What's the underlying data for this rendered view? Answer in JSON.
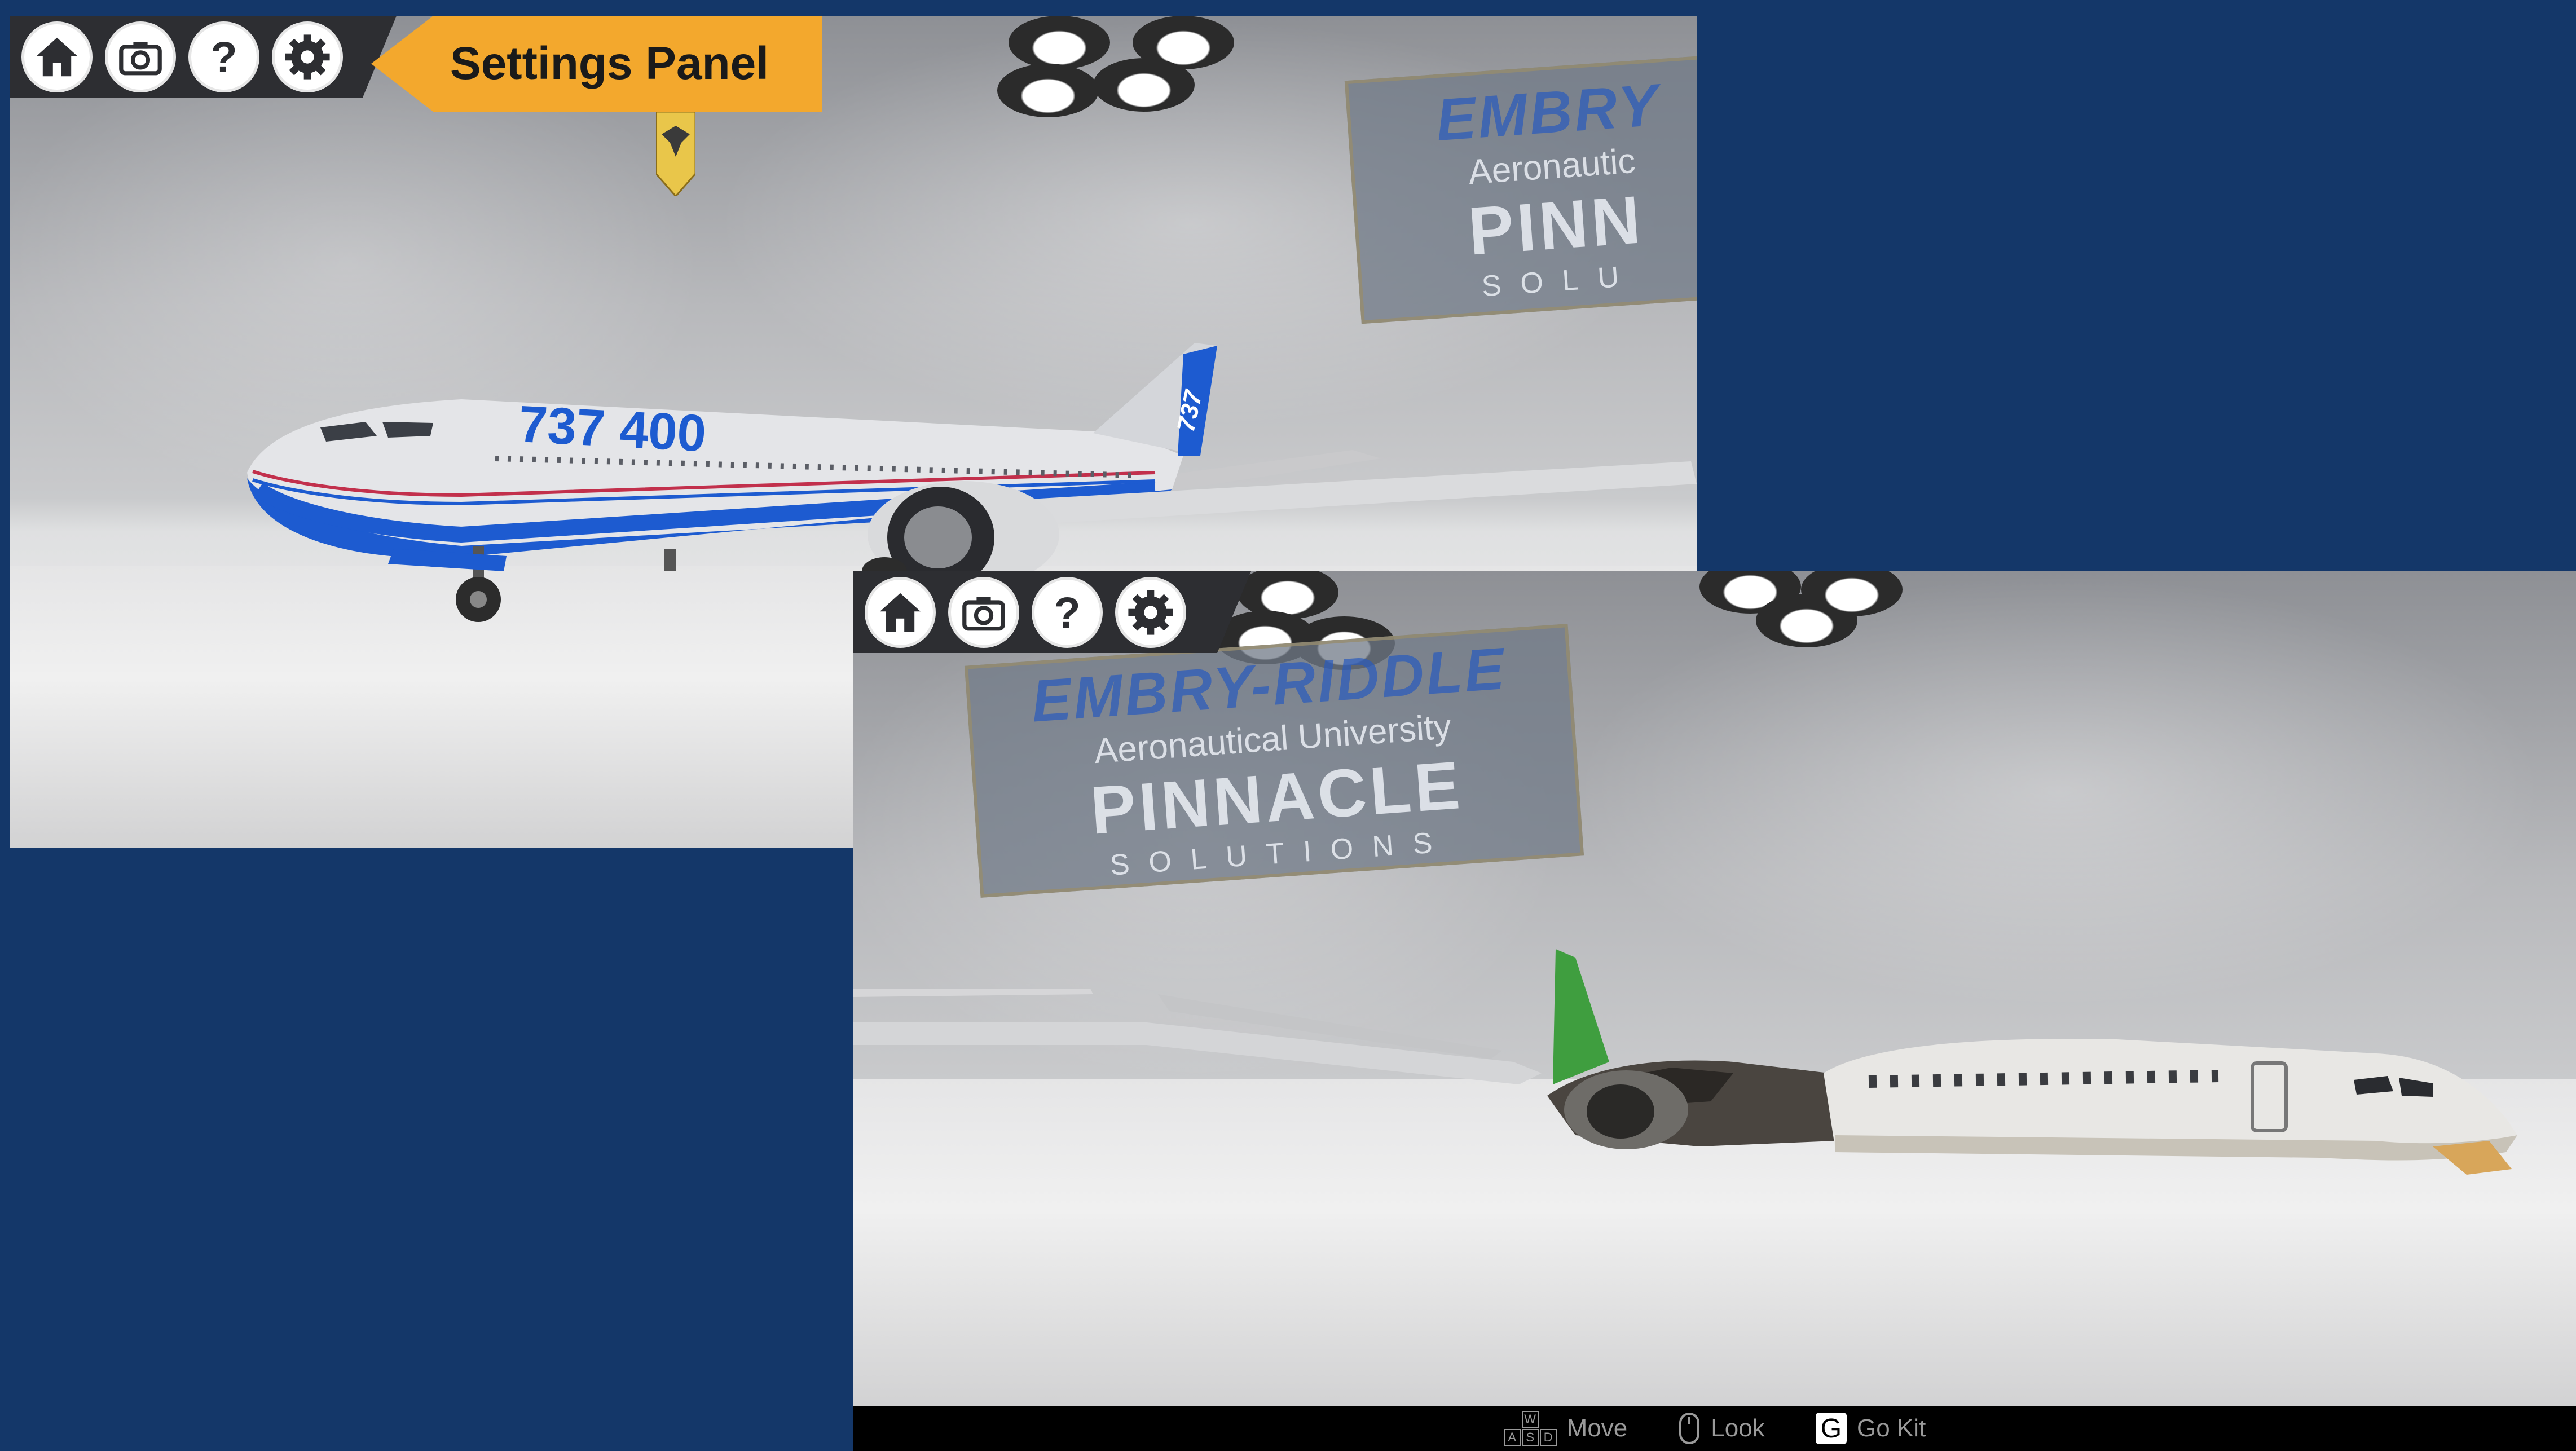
{
  "toolbar": {
    "home_label": "Home",
    "camera_label": "Camera",
    "help_label": "Help",
    "settings_label": "Settings"
  },
  "callout": {
    "text": "Settings Panel"
  },
  "aircraft_top": {
    "livery_text": "737 400",
    "tail_text": "737"
  },
  "banner": {
    "line1": "EMBRY-RIDDLE",
    "line2": "Aeronautical University",
    "line3": "PINNACLE",
    "line4": "SOLUTIONS"
  },
  "banner_partial": {
    "line1": "EMBRY",
    "line2": "Aeronautic",
    "line3": "PINN",
    "line4": "SOLU"
  },
  "controls": {
    "move_keys": [
      "W",
      "A",
      "S",
      "D"
    ],
    "move_label": "Move",
    "look_label": "Look",
    "go_kit_key": "G",
    "go_kit_label": "Go Kit"
  },
  "colors": {
    "background": "#143769",
    "toolbar": "#2d2e32",
    "callout": "#f3a82d",
    "livery_blue": "#1d5bd0"
  }
}
